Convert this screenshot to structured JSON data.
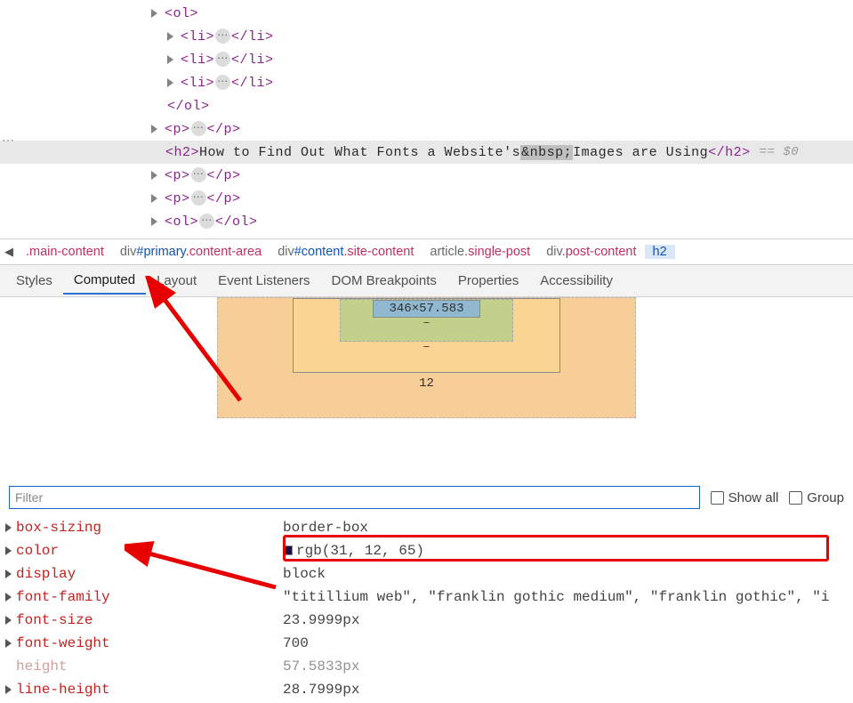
{
  "dom_tree": {
    "ol_open": "<ol>",
    "ol_close": "</ol>",
    "li_open": "<li>",
    "li_close": "</li>",
    "p_open": "<p>",
    "p_close": "</p>",
    "ol_open2": "<ol>",
    "ol_close2": "</ol>",
    "selected": {
      "tag_open": "<h2>",
      "text_before": "How to Find Out What Fonts a Website's",
      "nbsp": "&nbsp;",
      "text_after": "Images are Using",
      "tag_close": "</h2>",
      "hint": "== $0"
    },
    "ellipsis": "⋯",
    "gutter": "⋯"
  },
  "breadcrumb": {
    "items": [
      {
        "text": ".main-content",
        "cls": "bc-cls"
      },
      {
        "tag": "div",
        "id": "#primary",
        "cls": ".content-area"
      },
      {
        "tag": "div",
        "id": "#content",
        "cls": ".site-content"
      },
      {
        "tag": "article",
        "cls": ".single-post"
      },
      {
        "tag": "div",
        "cls": ".post-content"
      },
      {
        "tag": "h2",
        "active": true
      }
    ]
  },
  "tabs": {
    "items": [
      "Styles",
      "Computed",
      "Layout",
      "Event Listeners",
      "DOM Breakpoints",
      "Properties",
      "Accessibility"
    ],
    "active_index": 1
  },
  "box_model": {
    "content": "346×57.583",
    "padding_b": "–",
    "border_b": "–",
    "margin_b": "12"
  },
  "filter": {
    "placeholder": "Filter",
    "show_all": "Show all",
    "group": "Group"
  },
  "props": [
    {
      "name": "box-sizing",
      "value": "border-box"
    },
    {
      "name": "color",
      "value": "rgb(31, 12, 65)",
      "swatch": true
    },
    {
      "name": "display",
      "value": "block"
    },
    {
      "name": "font-family",
      "value": "\"titillium web\", \"franklin gothic medium\", \"franklin gothic\", \"i"
    },
    {
      "name": "font-size",
      "value": "23.9999px"
    },
    {
      "name": "font-weight",
      "value": "700"
    },
    {
      "name": "height",
      "value": "57.5833px",
      "gray": true
    },
    {
      "name": "line-height",
      "value": "28.7999px"
    }
  ]
}
